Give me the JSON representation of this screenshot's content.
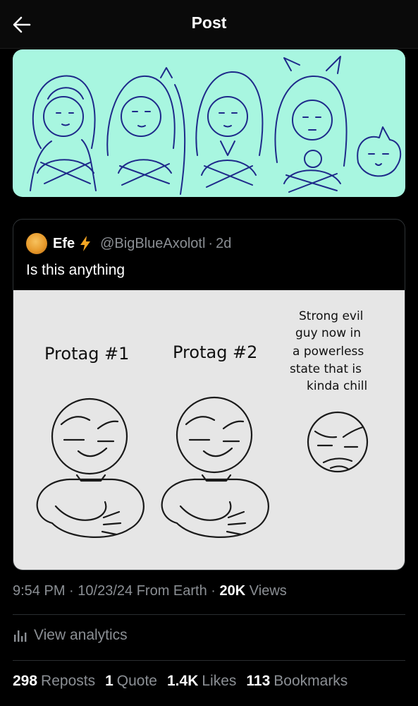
{
  "header": {
    "title": "Post",
    "back_icon": "arrow-left-icon"
  },
  "quoted_post": {
    "author_name": "Efe",
    "badge_icon": "lightning-bolt-icon",
    "badge_color": "#f5a623",
    "handle": "@BigBlueAxolotl",
    "separator": "·",
    "age": "2d",
    "text": "Is this anything",
    "image_labels": {
      "protag1": "Protag #1",
      "protag2": "Protag #2",
      "evil_line1": "Strong evil",
      "evil_line2": "guy now in",
      "evil_line3": "a powerless",
      "evil_line4": "state that is",
      "evil_line5": "kinda chill"
    }
  },
  "meta": {
    "time": "9:54 PM",
    "separator": "·",
    "date": "10/23/24",
    "source": "From Earth",
    "views_count": "20K",
    "views_label": "Views"
  },
  "analytics": {
    "label": "View analytics",
    "icon": "bar-chart-icon"
  },
  "stats": {
    "reposts_count": "298",
    "reposts_label": "Reposts",
    "quotes_count": "1",
    "quotes_label": "Quote",
    "likes_count": "1.4K",
    "likes_label": "Likes",
    "bookmarks_count": "113",
    "bookmarks_label": "Bookmarks"
  },
  "colors": {
    "background": "#000000",
    "top_image_bg": "#a8f6e0",
    "line_art": "#1e2a8a",
    "muted_text": "#8b8f94"
  }
}
